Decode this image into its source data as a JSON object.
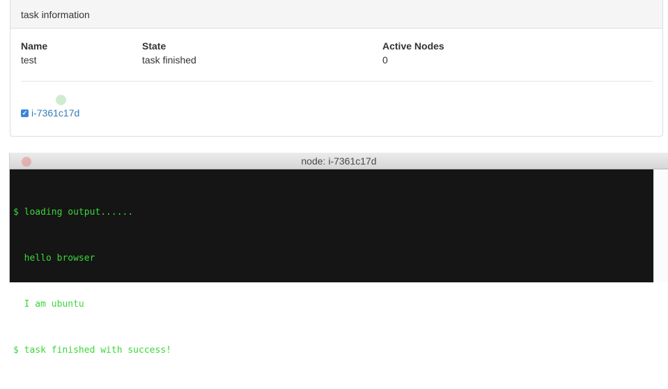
{
  "panel": {
    "heading": "task information",
    "columns": [
      {
        "header": "Name",
        "value": "test"
      },
      {
        "header": "State",
        "value": "task finished"
      },
      {
        "header": "Active Nodes",
        "value": "0"
      }
    ],
    "node": {
      "label": "i-7361c17d",
      "checked": true
    }
  },
  "terminal": {
    "title": "node: i-7361c17d",
    "lines": [
      "$ loading output......",
      "  hello browser",
      "  I am ubuntu",
      "$ task finished with success!"
    ],
    "text_color": "#3ad73a",
    "background": "#151515"
  },
  "colors": {
    "link": "#337ab7",
    "checkbox": "#3b85d8"
  }
}
